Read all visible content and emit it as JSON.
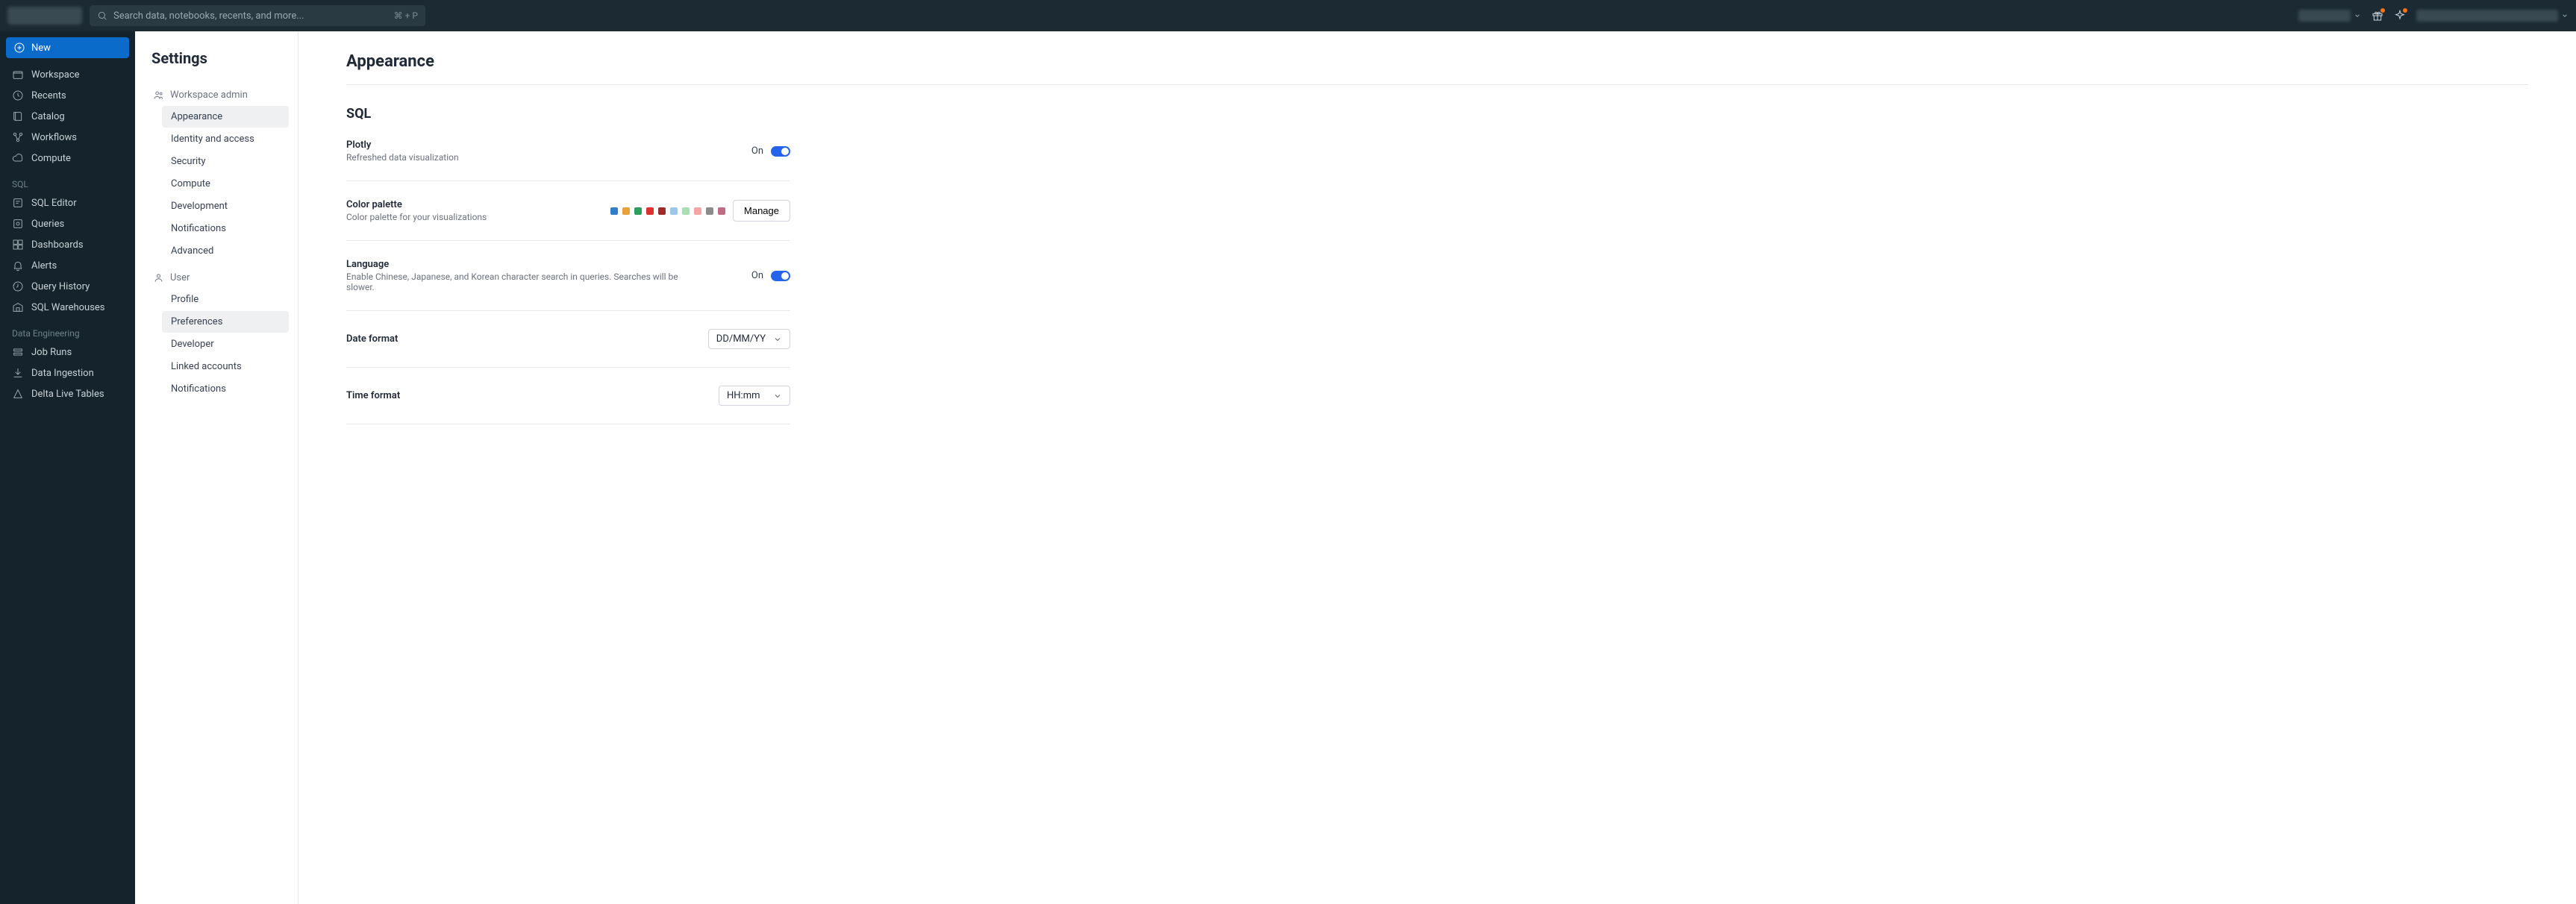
{
  "topbar": {
    "search_placeholder": "Search data, notebooks, recents, and more...",
    "search_shortcut": "⌘ + P"
  },
  "leftnav": {
    "new_label": "New",
    "items_primary": [
      {
        "label": "Workspace",
        "icon": "folder"
      },
      {
        "label": "Recents",
        "icon": "clock"
      },
      {
        "label": "Catalog",
        "icon": "book"
      },
      {
        "label": "Workflows",
        "icon": "flow"
      },
      {
        "label": "Compute",
        "icon": "cloud"
      }
    ],
    "section_sql": "SQL",
    "items_sql": [
      {
        "label": "SQL Editor",
        "icon": "sql"
      },
      {
        "label": "Queries",
        "icon": "query"
      },
      {
        "label": "Dashboards",
        "icon": "dashboard"
      },
      {
        "label": "Alerts",
        "icon": "bell"
      },
      {
        "label": "Query History",
        "icon": "history"
      },
      {
        "label": "SQL Warehouses",
        "icon": "warehouse"
      }
    ],
    "section_de": "Data Engineering",
    "items_de": [
      {
        "label": "Job Runs",
        "icon": "jobs"
      },
      {
        "label": "Data Ingestion",
        "icon": "ingest"
      },
      {
        "label": "Delta Live Tables",
        "icon": "delta"
      }
    ]
  },
  "settings_col": {
    "title": "Settings",
    "section_ws": "Workspace admin",
    "ws_items": [
      "Appearance",
      "Identity and access",
      "Security",
      "Compute",
      "Development",
      "Notifications",
      "Advanced"
    ],
    "section_user": "User",
    "user_items": [
      "Profile",
      "Preferences",
      "Developer",
      "Linked accounts",
      "Notifications"
    ],
    "active_ws": "Appearance",
    "active_user": "Preferences"
  },
  "main": {
    "heading": "Appearance",
    "subheading": "SQL",
    "on_label": "On",
    "plotly": {
      "title": "Plotly",
      "desc": "Refreshed data visualization",
      "state": "On"
    },
    "palette": {
      "title": "Color palette",
      "desc": "Color palette for your visualizations",
      "colors": [
        "#2F7EC7",
        "#E9A13B",
        "#2E9E5B",
        "#E02F2F",
        "#9C2B2E",
        "#9FC8E8",
        "#A8DDB5",
        "#F4A6A6",
        "#8C8C8C",
        "#C06C84"
      ],
      "manage_label": "Manage"
    },
    "language": {
      "title": "Language",
      "desc": "Enable Chinese, Japanese, and Korean character search in queries. Searches will be slower.",
      "state": "On"
    },
    "date": {
      "title": "Date format",
      "value": "DD/MM/YY"
    },
    "time": {
      "title": "Time format",
      "value": "HH:mm"
    }
  }
}
